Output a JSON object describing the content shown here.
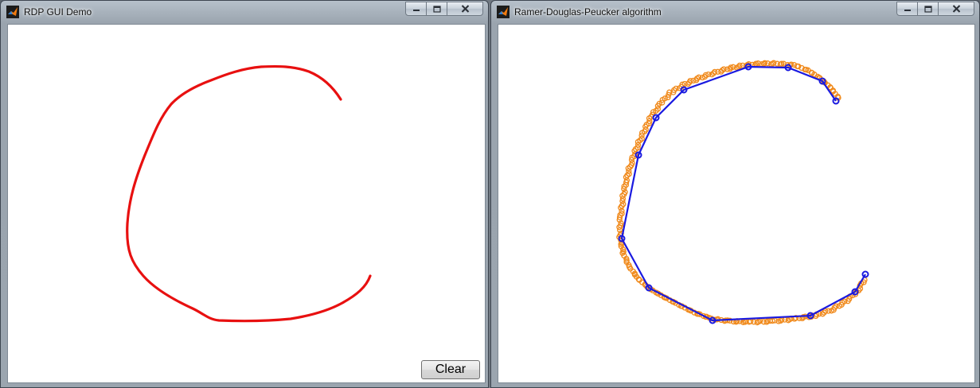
{
  "windows": [
    {
      "title": "RDP GUI Demo",
      "icon": "matlab-icon",
      "buttons": {
        "clear_label": "Clear"
      },
      "stroke_color": "#e81010"
    },
    {
      "title": "Ramer-Douglas-Peucker algorithm",
      "icon": "matlab-icon",
      "colors": {
        "original_points": "#f08a1c",
        "simplified_line": "#1a1ae0"
      }
    }
  ],
  "window_controls": [
    "minimize-icon",
    "maximize-icon",
    "close-icon"
  ]
}
